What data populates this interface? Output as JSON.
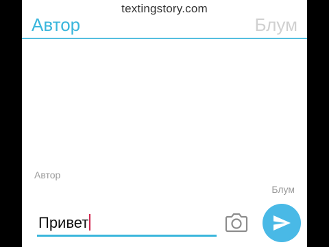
{
  "watermark": "textingstory.com",
  "tabs": {
    "left_label": "Автор",
    "right_label": "Блум"
  },
  "messages": [
    {
      "sender": "Автор",
      "side": "left"
    },
    {
      "sender": "Блум",
      "side": "right"
    }
  ],
  "composer": {
    "input_value": "Привет",
    "camera_icon": "camera-icon",
    "send_icon": "send-icon"
  },
  "colors": {
    "accent": "#3ab6dc",
    "send_button": "#49b9e6",
    "inactive_tab": "#d0d0d0",
    "caret": "#d0264e"
  }
}
